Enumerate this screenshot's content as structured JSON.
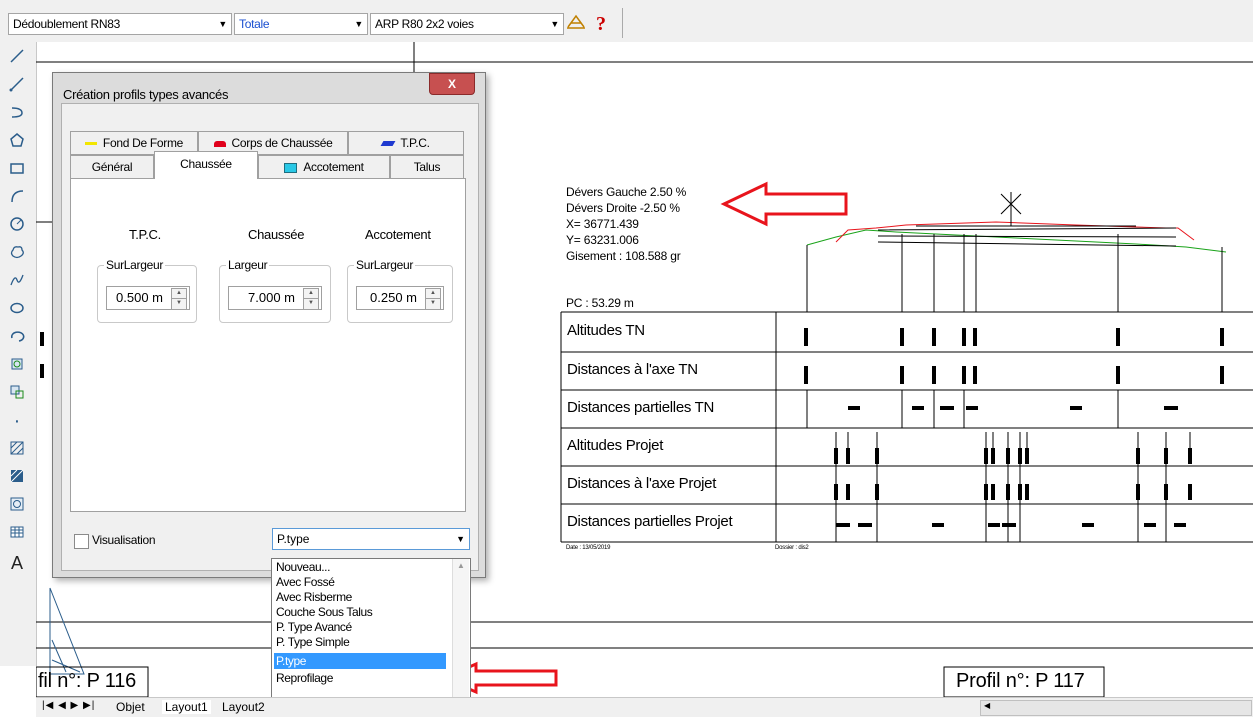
{
  "toolbar": {
    "layer_combo": "Dédoublement RN83",
    "view_combo": "Totale",
    "profile_combo": "ARP R80 2x2 voies",
    "profile_icon": "profile-icon",
    "help_icon": "help-icon",
    "dropdown_arrow": "▼"
  },
  "dialog": {
    "title": "Création profils types avancés",
    "close_label": "X",
    "tabs_back": [
      "Fond De Forme",
      "Corps de Chaussée",
      "T.P.C."
    ],
    "tabs_front": [
      "Général",
      "Chaussée",
      "Accotement",
      "Talus"
    ],
    "active_tab": "Chaussée",
    "columns": [
      {
        "heading": "T.P.C.",
        "group": "SurLargeur",
        "value": "0.500 m"
      },
      {
        "heading": "Chaussée",
        "group": "Largeur",
        "value": "7.000 m"
      },
      {
        "heading": "Accotement",
        "group": "SurLargeur",
        "value": "0.250 m"
      }
    ],
    "visualisation_label": "Visualisation",
    "ptype_value": "P.type",
    "colors": {
      "yellow": "#f2e600",
      "red": "#e0001b",
      "blue": "#1f3ad0",
      "cyan": "#29c8e6"
    }
  },
  "dropdown": {
    "items": [
      "Nouveau...",
      "Avec Fossé",
      "Avec Risberme",
      "Couche Sous Talus",
      "P. Type Avancé",
      "P. Type Simple",
      "P.type",
      "Reprofilage"
    ],
    "selected": "P.type"
  },
  "drawing": {
    "info": [
      "Dévers Gauche 2.50 %",
      "Dévers Droite -2.50 %",
      "X= 36771.439",
      "Y= 63231.006",
      "Gisement : 108.588 gr"
    ],
    "pc": "PC : 53.29 m",
    "rows": [
      "Altitudes TN",
      "Distances à l'axe TN",
      "Distances partielles TN",
      "Altitudes Projet",
      "Distances à l'axe Projet",
      "Distances partielles Projet"
    ],
    "date": "Date : 13/05/2019",
    "dossier": "Dossier : dis2",
    "profil_left": "fil n°: P 116",
    "profil_right": "Profil n°: P 117",
    "arrow_color": "#e8141c"
  },
  "bottom_tabs": [
    "Objet",
    "Layout1",
    "Layout2"
  ]
}
